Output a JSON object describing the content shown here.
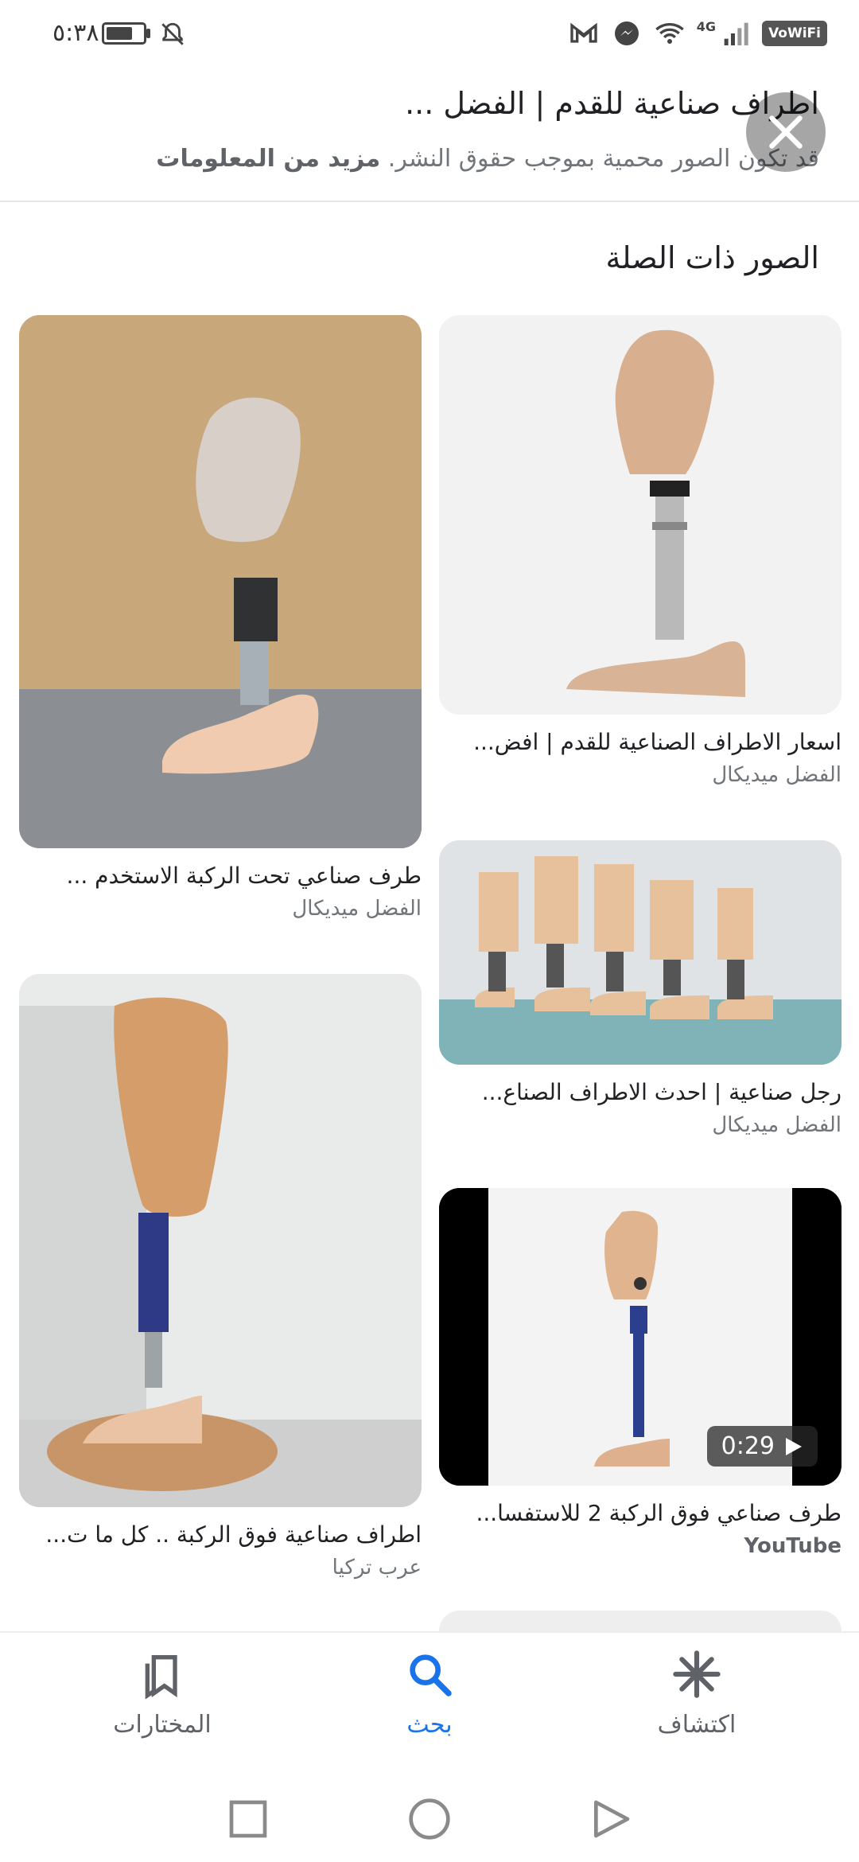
{
  "status_bar": {
    "time": "٥:٣٨",
    "network_badge": "VoWiFi",
    "net_type": "4G"
  },
  "header": {
    "title": "اطراف صناعية للقدم | الفضل ...",
    "copyright_note": "قد تكون الصور محمية بموجب حقوق النشر.",
    "more_info": "مزيد من المعلومات"
  },
  "section": {
    "title": "الصور ذات الصلة"
  },
  "cards": [
    {
      "title": "اسعار الاطراف الصناعية للقدم | افض...",
      "source": "الفضل ميديكال"
    },
    {
      "title": "طرف صناعي تحت الركبة الاستخدم ...",
      "source": "الفضل ميديكال"
    },
    {
      "title": "رجل صناعية | احدث الاطراف الصناع...",
      "source": "الفضل ميديكال"
    },
    {
      "title": "اطراف صناعية فوق الركبة .. كل ما ت...",
      "source": "عرب تركيا"
    },
    {
      "title": "طرف صناعي فوق الركبة 2 للاستفسا...",
      "source": "YouTube",
      "duration": "0:29"
    }
  ],
  "bottom_nav": {
    "saved": "المختارات",
    "search": "بحث",
    "discover": "اكتشاف"
  }
}
